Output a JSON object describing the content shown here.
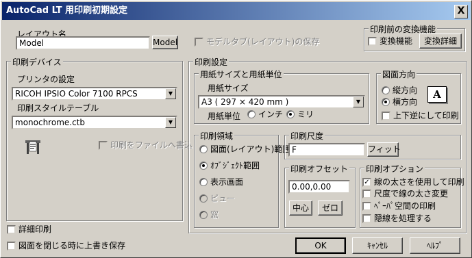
{
  "window": {
    "title": "AutoCad LT 用印刷初期設定",
    "close": "X"
  },
  "layout": {
    "label": "レイアウト名",
    "name_value": "Model",
    "model_button": "Model",
    "save_model_tab": "モデルタブ(レイアウト)の保存"
  },
  "convert": {
    "title": "印刷前の変換機能",
    "checkbox": "変換機能",
    "detail_button": "変換詳細"
  },
  "device": {
    "title": "印刷デバイス",
    "printer_label": "プリンタの設定",
    "printer_value": "RICOH IPSIO Color 7100 RPCS",
    "style_label": "印刷スタイルテーブル",
    "style_value": "monochrome.ctb",
    "print_to_file": "印刷をファイルへ書込"
  },
  "settings": {
    "title": "印刷設定",
    "paper": {
      "title": "用紙サイズと用紙単位",
      "size_label": "用紙サイズ",
      "size_value": "A3 ( 297 × 420 mm )",
      "unit_label": "用紙単位",
      "unit_inch": "インチ",
      "unit_mm": "ミリ"
    },
    "orientation": {
      "title": "図面方向",
      "portrait": "縦方向",
      "landscape": "横方向",
      "upside": "上下逆にして印刷",
      "icon_letter": "A"
    },
    "area": {
      "title": "印刷領域",
      "limits": "図面(レイアウト)範囲",
      "extents": "ｵﾌﾞｼﾞｪｸﾄ範囲",
      "display": "表示画面",
      "view": "ビュー",
      "window": "窓"
    },
    "scale": {
      "title": "印刷尺度",
      "value": "F",
      "fit_button": "フィット"
    },
    "offset": {
      "title": "印刷オフセット",
      "value": "0.00,0.00",
      "center_button": "中心",
      "zero_button": "ゼロ"
    },
    "options": {
      "title": "印刷オプション",
      "lineweight": "線の太さを使用して印刷",
      "scale_lw": "尺度で線の太さ変更",
      "paperspace": "ﾍﾟｰﾊﾟ空間の印刷",
      "hide": "隠線を処理する"
    }
  },
  "bottom": {
    "detail_print": "詳細印刷",
    "overwrite": "図面を閉じる時に上書き保存"
  },
  "buttons": {
    "ok": "OK",
    "cancel": "ｷｬﾝｾﾙ",
    "help": "ﾍﾙﾌﾟ"
  }
}
